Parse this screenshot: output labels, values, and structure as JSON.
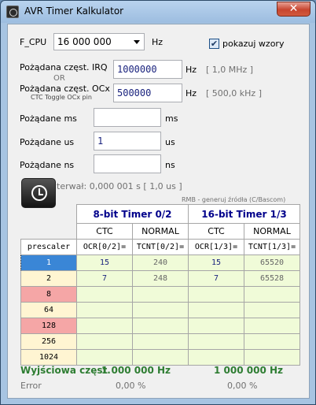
{
  "window": {
    "title": "AVR Timer Kalkulator",
    "close_symbol": "✕"
  },
  "fcpu": {
    "label": "F_CPU",
    "value": "16 000 000",
    "unit": "Hz"
  },
  "show_formulas": {
    "label": "pokazuj wzory",
    "checked": true,
    "check_symbol": "✔"
  },
  "irq": {
    "label": "Pożądana częst. IRQ",
    "value": "1000000",
    "unit": "Hz",
    "info": "[ 1,0 MHz ]"
  },
  "or_label": "OR",
  "ocx": {
    "label": "Pożądana częst. OCx",
    "sublabel": "CTC Toggle OCx pin",
    "value": "500000",
    "unit": "Hz",
    "info": "[ 500,0 kHz ]"
  },
  "ms": {
    "label": "Pożądane ms",
    "value": "",
    "unit": "ms"
  },
  "us": {
    "label": "Pożądane us",
    "value": "1",
    "unit": "us"
  },
  "ns": {
    "label": "Pożądane ns",
    "value": "",
    "unit": "ns"
  },
  "interval": "interwał:  0,000 001 s  [ 1,0 us ]",
  "rmb_hint": "RMB - generuj źródła (C/Bascom)",
  "table": {
    "timer8_title": "8-bit Timer 0/2",
    "timer16_title": "16-bit Timer 1/3",
    "mode_ctc": "CTC",
    "mode_normal": "NORMAL",
    "prescaler_header": "prescaler",
    "col_ocr02": "OCR[0/2]=",
    "col_tcnt02": "TCNT[0/2]=",
    "col_ocr13": "OCR[1/3]=",
    "col_tcnt13": "TCNT[1/3]=",
    "rows": [
      {
        "prescaler": "1",
        "ocr02": "15",
        "tcnt02": "240",
        "ocr13": "15",
        "tcnt13": "65520",
        "state": "selected"
      },
      {
        "prescaler": "2",
        "ocr02": "7",
        "tcnt02": "248",
        "ocr13": "7",
        "tcnt13": "65528",
        "state": "ok"
      },
      {
        "prescaler": "8",
        "ocr02": "",
        "tcnt02": "",
        "ocr13": "",
        "tcnt13": "",
        "state": "bad"
      },
      {
        "prescaler": "64",
        "ocr02": "",
        "tcnt02": "",
        "ocr13": "",
        "tcnt13": "",
        "state": "ok"
      },
      {
        "prescaler": "128",
        "ocr02": "",
        "tcnt02": "",
        "ocr13": "",
        "tcnt13": "",
        "state": "bad"
      },
      {
        "prescaler": "256",
        "ocr02": "",
        "tcnt02": "",
        "ocr13": "",
        "tcnt13": "",
        "state": "ok"
      },
      {
        "prescaler": "1024",
        "ocr02": "",
        "tcnt02": "",
        "ocr13": "",
        "tcnt13": "",
        "state": "ok"
      }
    ]
  },
  "output": {
    "label": "Wyjściowa częst.",
    "value8": "1 000 000 Hz",
    "value16": "1 000 000 Hz",
    "error_label": "Error",
    "error8": "0,00 %",
    "error16": "0,00 %"
  },
  "colors": {
    "accent_blue": "#00008b",
    "output_green": "#2e7d32",
    "invalid_red": "#f5a6a6",
    "valid_yellow": "#fff5d2",
    "cell_green": "#f0fbd8"
  }
}
